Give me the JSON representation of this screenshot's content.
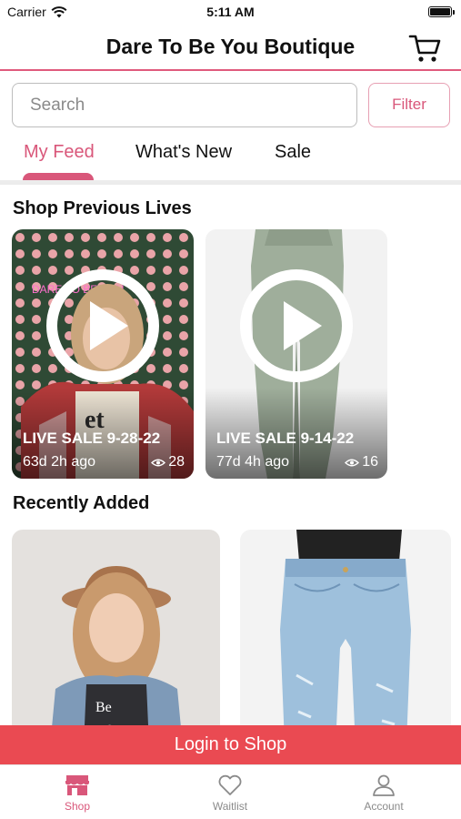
{
  "status_bar": {
    "carrier": "Carrier",
    "time": "5:11 AM"
  },
  "header": {
    "title": "Dare To Be You Boutique"
  },
  "search": {
    "placeholder": "Search",
    "filter_label": "Filter"
  },
  "tabs": [
    {
      "label": "My Feed",
      "active": true
    },
    {
      "label": "What's New",
      "active": false
    },
    {
      "label": "Sale",
      "active": false
    }
  ],
  "sections": {
    "previous_lives": "Shop Previous Lives",
    "recently_added": "Recently Added"
  },
  "live_sales": [
    {
      "title": "LIVE SALE 9-28-22",
      "age": "63d 2h ago",
      "views": "28"
    },
    {
      "title": "LIVE SALE 9-14-22",
      "age": "77d 4h ago",
      "views": "16"
    }
  ],
  "login_banner": "Login to Shop",
  "bottom_nav": [
    {
      "label": "Shop",
      "icon": "store-icon",
      "active": true
    },
    {
      "label": "Waitlist",
      "icon": "heart-icon",
      "active": false
    },
    {
      "label": "Account",
      "icon": "person-icon",
      "active": false
    }
  ],
  "colors": {
    "accent": "#d9577a",
    "banner": "#ea4a52",
    "header_rule": "#e05a7c"
  }
}
